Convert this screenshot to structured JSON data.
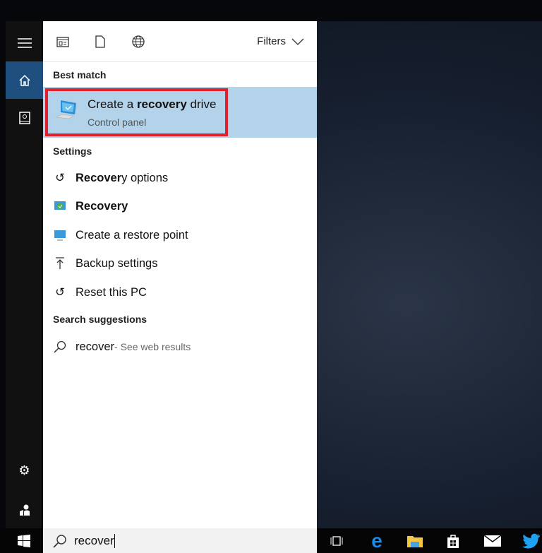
{
  "toolbar": {
    "filters_label": "Filters"
  },
  "best_match": {
    "heading": "Best match",
    "title_pre": "Create a ",
    "title_bold": "recovery",
    "title_post": " drive",
    "subtitle": "Control panel"
  },
  "settings": {
    "heading": "Settings",
    "items": [
      {
        "bold": "Recover",
        "rest": "y options"
      },
      {
        "bold": "Recovery",
        "rest": ""
      },
      {
        "bold": "",
        "rest": "Create a restore point"
      },
      {
        "bold": "",
        "rest": "Backup settings"
      },
      {
        "bold": "",
        "rest": "Reset this PC"
      }
    ]
  },
  "suggestions": {
    "heading": "Search suggestions",
    "query": "recover",
    "web": " - See web results"
  },
  "search": {
    "value": "recover"
  },
  "colors": {
    "accent": "#1e4f7e",
    "highlight": "#b3d3ea",
    "red": "#e0202a"
  }
}
